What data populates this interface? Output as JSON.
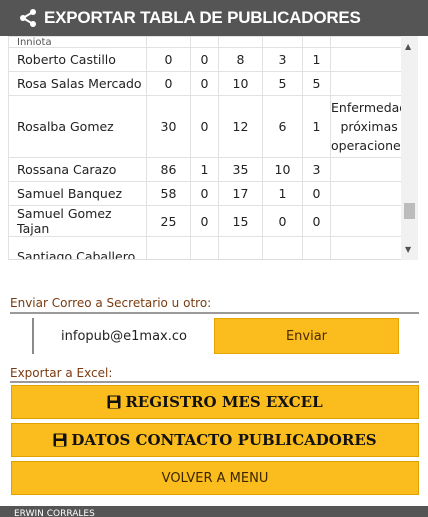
{
  "header": {
    "title": "EXPORTAR TABLA DE PUBLICADORES",
    "icon": "share-icon"
  },
  "table": {
    "top_partial_name": "Inniota",
    "rows": [
      {
        "name": "Roberto Castillo",
        "c1": "0",
        "c2": "0",
        "c3": "8",
        "c4": "3",
        "c5": "1",
        "obs": ""
      },
      {
        "name": "Rosa Salas Mercado",
        "c1": "0",
        "c2": "0",
        "c3": "10",
        "c4": "5",
        "c5": "5",
        "obs": ""
      },
      {
        "name": "Rosalba Gomez",
        "c1": "30",
        "c2": "0",
        "c3": "12",
        "c4": "6",
        "c5": "1",
        "obs": "Enfermedad próximas operaciones"
      },
      {
        "name": "Rossana Carazo",
        "c1": "86",
        "c2": "1",
        "c3": "35",
        "c4": "10",
        "c5": "3",
        "obs": ""
      },
      {
        "name": "Samuel Banquez",
        "c1": "58",
        "c2": "0",
        "c3": "17",
        "c4": "1",
        "c5": "0",
        "obs": ""
      },
      {
        "name": "Samuel Gomez Tajan",
        "c1": "25",
        "c2": "0",
        "c3": "15",
        "c4": "0",
        "c5": "0",
        "obs": ""
      },
      {
        "name": "Santiago Caballero",
        "c1": "",
        "c2": "",
        "c3": "",
        "c4": "",
        "c5": "",
        "obs": ""
      }
    ]
  },
  "email_section": {
    "label": "Enviar Correo a Secretario u otro:",
    "email_value": "infopub@e1max.co",
    "send_label": "Enviar"
  },
  "export_section": {
    "label": "Exportar a Excel:",
    "registro_label": "REGISTRO MES EXCEL",
    "contactos_label": "DATOS CONTACTO PUBLICADORES",
    "volver_label": "VOLVER A MENU"
  },
  "footer": {
    "text": "ERWIN CORRALES"
  },
  "colors": {
    "header_bg": "#555555",
    "button_bg": "#fbbd1e",
    "label_color": "#7a3b10"
  }
}
